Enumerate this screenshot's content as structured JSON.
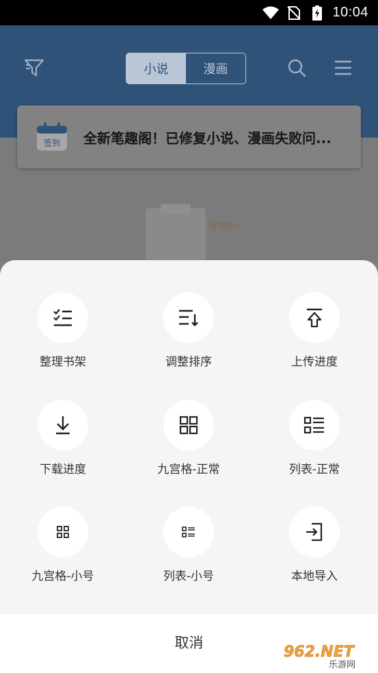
{
  "status_bar": {
    "time": "10:04",
    "icons": [
      "wifi-icon",
      "no-sim-icon",
      "battery-charging-icon"
    ]
  },
  "app_bar": {
    "left_icon": "filter-icon",
    "tabs": [
      {
        "label": "小说",
        "active": true
      },
      {
        "label": "漫画",
        "active": false
      }
    ],
    "right_icons": [
      "search-icon",
      "menu-icon"
    ]
  },
  "notice": {
    "icon": "calendar-checkin-icon",
    "icon_label": "签到",
    "text": "全新笔趣阁！已修复小说、漫画失败问..."
  },
  "empty_state": {
    "label": "没书啦~"
  },
  "sheet": {
    "items": [
      {
        "icon": "organize-list-icon",
        "label": "整理书架"
      },
      {
        "icon": "sort-icon",
        "label": "调整排序"
      },
      {
        "icon": "upload-icon",
        "label": "上传进度"
      },
      {
        "icon": "download-icon",
        "label": "下载进度"
      },
      {
        "icon": "grid-icon",
        "label": "九宫格-正常"
      },
      {
        "icon": "list-icon",
        "label": "列表-正常"
      },
      {
        "icon": "grid-small-icon",
        "label": "九宫格-小号"
      },
      {
        "icon": "list-small-icon",
        "label": "列表-小号"
      },
      {
        "icon": "import-icon",
        "label": "本地导入"
      }
    ],
    "cancel_label": "取消"
  },
  "watermark": {
    "text_top": "962.NET",
    "text_bottom": "乐游网"
  },
  "colors": {
    "app_bar_dimmed": "#2f5278",
    "sheet_bg": "#f5f5f5",
    "text": "#333333"
  }
}
